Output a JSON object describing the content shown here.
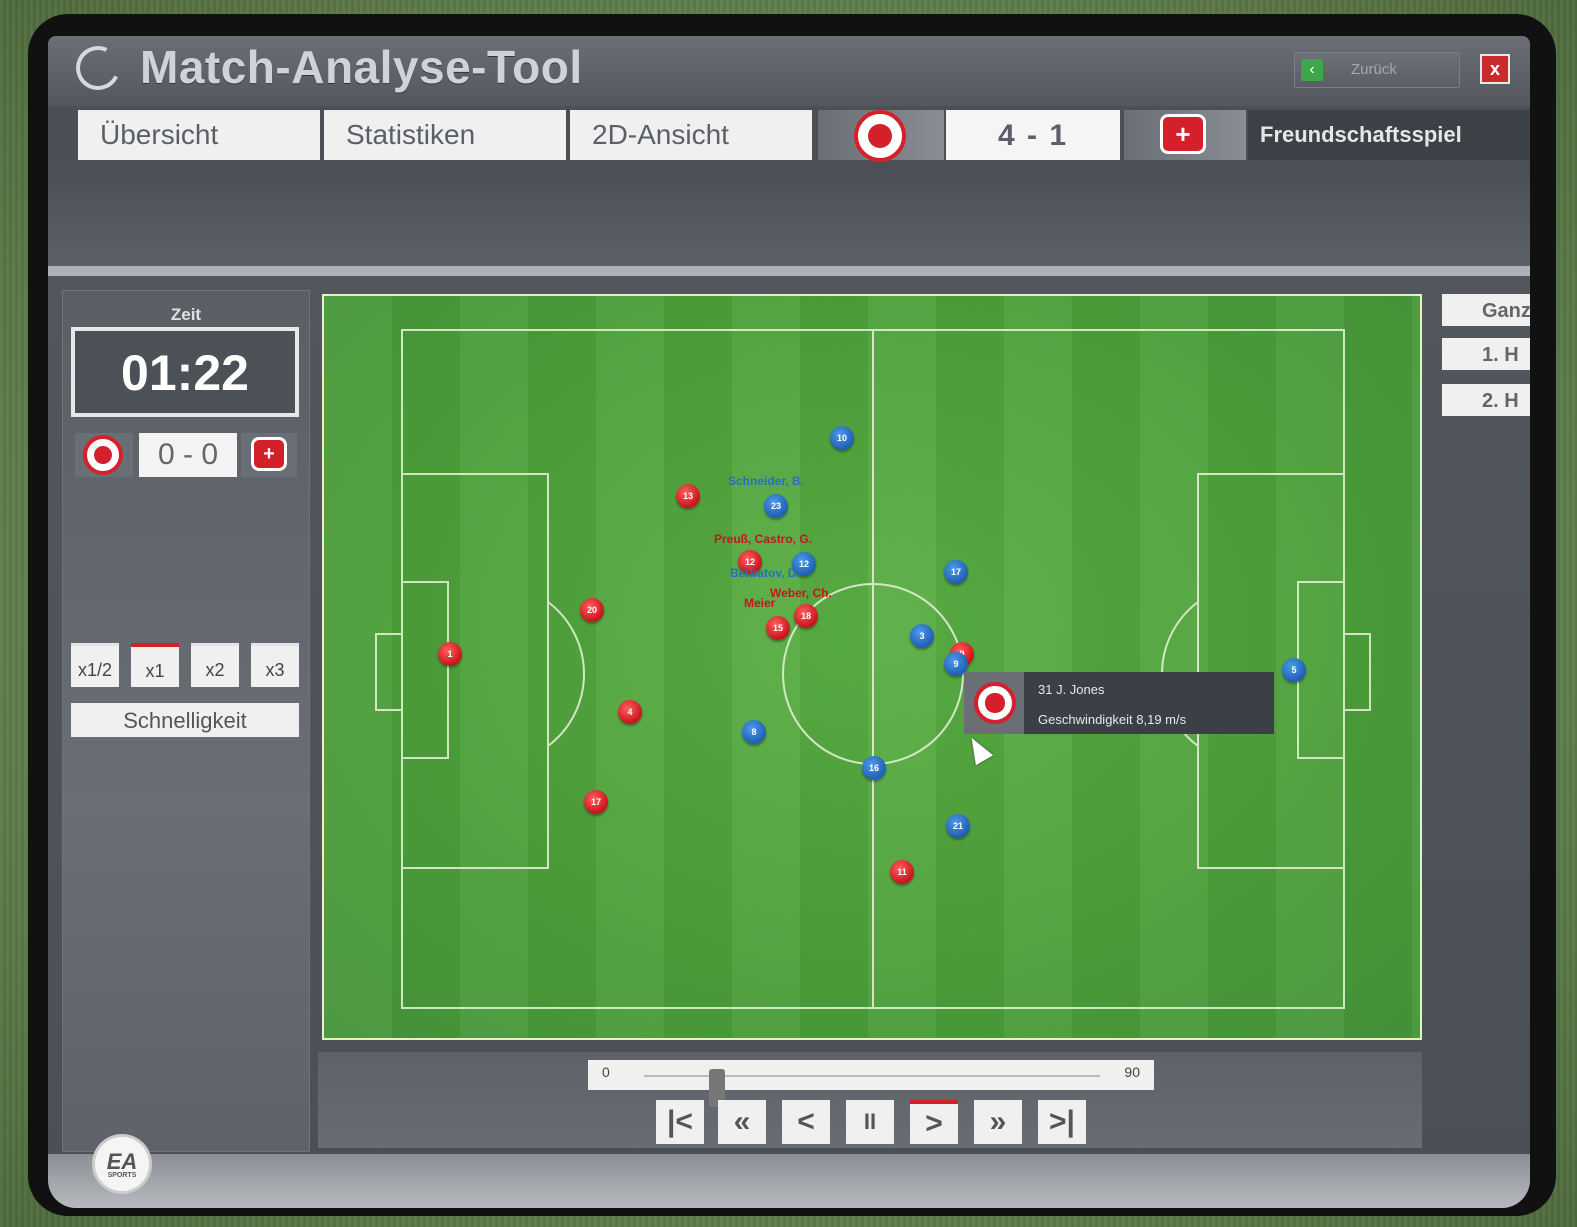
{
  "window": {
    "title": "Match-Analyse-Tool",
    "back_label": "Zurück",
    "close_label": "x"
  },
  "tabs": [
    {
      "label": "Übersicht"
    },
    {
      "label": "Statistiken"
    },
    {
      "label": "2D-Ansicht"
    }
  ],
  "match": {
    "home_crest": "eagle-crest-icon",
    "away_crest": "bayer-cross-crest-icon",
    "final_score": "4 - 1",
    "match_type": "Freundschaftsspiel"
  },
  "left_panel": {
    "time_label": "Zeit",
    "time": "01:22",
    "live_score": "0 - 0",
    "speed_options": [
      "x1/2",
      "x1",
      "x2",
      "x3"
    ],
    "active_speed": "x1",
    "speed_label": "Schnelligkeit"
  },
  "right_panel": {
    "buttons": [
      "Ganz",
      "1. H",
      "2. H"
    ]
  },
  "pitch": {
    "red_players": [
      "1",
      "20",
      "13",
      "4",
      "17",
      "12",
      "15",
      "18",
      "11",
      "9"
    ],
    "blue_players": [
      "10",
      "23",
      "17",
      "12",
      "3",
      "9",
      "8",
      "16",
      "5",
      "21"
    ],
    "labels": {
      "blue_1": "Schneider, B.",
      "red_1": "Preuß, Castro, G.",
      "blue_2": "Berbatov, D.",
      "red_2": "Weber, Ch.",
      "red_3": "Meier"
    },
    "tooltip": {
      "player": "31 J. Jones",
      "speed": "Geschwindigkeit 8,19 m/s"
    }
  },
  "playback": {
    "timeline_start": "0",
    "timeline_end": "90",
    "position_minute": 1.37,
    "buttons": [
      {
        "glyph": "|<",
        "name": "skip-start-icon"
      },
      {
        "glyph": "«",
        "name": "rewind-icon"
      },
      {
        "glyph": "<",
        "name": "step-back-icon"
      },
      {
        "glyph": "II",
        "name": "pause-icon"
      },
      {
        "glyph": ">",
        "name": "play-icon"
      },
      {
        "glyph": "»",
        "name": "fast-forward-icon"
      },
      {
        "glyph": ">|",
        "name": "skip-end-icon"
      }
    ]
  },
  "branding": {
    "logo": "EA",
    "logo_sub": "SPORTS"
  },
  "colors": {
    "home_red": "#d3202a",
    "away_blue": "#1f5fb5",
    "pitch_green": "#4c9f3a"
  }
}
